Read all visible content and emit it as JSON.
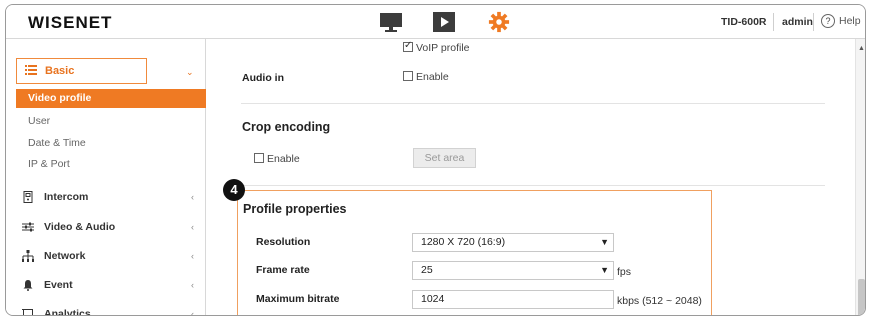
{
  "header": {
    "logo": "WISENET",
    "model": "TID-600R",
    "user": "admin",
    "help_label": "Help",
    "nav_icons": [
      "monitor-icon",
      "play-icon",
      "gear-icon"
    ],
    "accent_color": "#ef7a23"
  },
  "sidebar": {
    "basic_label": "Basic",
    "basic_items": [
      "Video profile",
      "User",
      "Date & Time",
      "IP & Port"
    ],
    "active_item": "Video profile",
    "groups": [
      {
        "label": "Intercom",
        "icon": "intercom-icon"
      },
      {
        "label": "Video & Audio",
        "icon": "sliders-icon"
      },
      {
        "label": "Network",
        "icon": "network-icon"
      },
      {
        "label": "Event",
        "icon": "bell-icon"
      },
      {
        "label": "Analytics",
        "icon": "analytics-icon"
      }
    ]
  },
  "main": {
    "voip_label": "VoIP profile",
    "audio_in_label": "Audio in",
    "audio_in_enable": "Enable",
    "crop_title": "Crop encoding",
    "crop_enable": "Enable",
    "set_area_label": "Set area",
    "badge": "4",
    "profile_title": "Profile properties",
    "resolution_label": "Resolution",
    "resolution_value": "1280 X 720 (16:9)",
    "frame_rate_label": "Frame rate",
    "frame_rate_value": "25",
    "frame_rate_unit": "fps",
    "bitrate_label": "Maximum bitrate",
    "bitrate_value": "1024",
    "bitrate_unit": "kbps (512 ~ 2048)"
  }
}
